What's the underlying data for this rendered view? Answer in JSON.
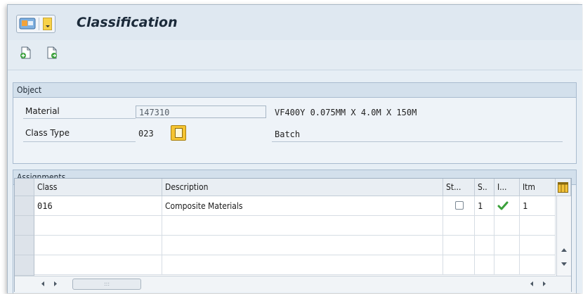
{
  "window": {
    "title": "Classification"
  },
  "icons": {
    "system_menu": "sap-system-menu-icon",
    "toolbar": [
      "create-assignment-icon",
      "insert-line-icon"
    ],
    "f4_help": "value-help-icon",
    "column_settings": "table-settings-icon",
    "indicator_ok": "checkmark-icon"
  },
  "object_group": {
    "title": "Object",
    "material_label": "Material",
    "material_value": "147310",
    "material_description": "VF400Y 0.075MM X 4.0M X 150M",
    "class_type_label": "Class Type",
    "class_type_value": "023",
    "class_type_description": "Batch"
  },
  "assignments": {
    "title": "Assignments",
    "columns": [
      "Class",
      "Description",
      "St...",
      "S..",
      "I...",
      "Itm"
    ],
    "rows": [
      {
        "class": "016",
        "description": "Composite Materials",
        "status_checked": false,
        "s": "1",
        "indicator": "ok",
        "itm": "1"
      }
    ],
    "scroll_dots": ":::"
  },
  "colors": {
    "accent": "#f5c431",
    "check_green": "#3aa03a",
    "header_bg": "#d3e0ec"
  }
}
